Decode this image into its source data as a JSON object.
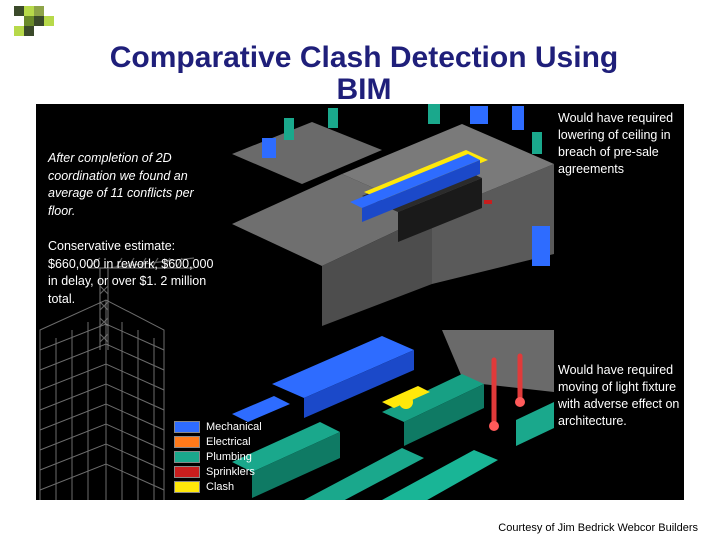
{
  "title_line1": "Comparative Clash Detection Using",
  "title_line2": "BIM",
  "left": {
    "p1": "After completion of 2D coordination we found an average of 11 conflicts per floor.",
    "p2": "Conservative estimate:  $660,000 in rework, $600,000 in delay, or over $1. 2 million total."
  },
  "captions": {
    "top": "Would have required lowering of ceiling in breach of pre-sale agreements",
    "bottom": "Would have required moving of light fixture with adverse effect on architecture."
  },
  "legend": [
    {
      "label": "Mechanical",
      "color": "#2e6cff"
    },
    {
      "label": "Electrical",
      "color": "#ff7a1a"
    },
    {
      "label": "Plumbing",
      "color": "#1aa88c"
    },
    {
      "label": "Sprinklers",
      "color": "#c81e1e"
    },
    {
      "label": "Clash",
      "color": "#ffe80a"
    }
  ],
  "credit": "Courtesy of Jim Bedrick  Webcor Builders"
}
